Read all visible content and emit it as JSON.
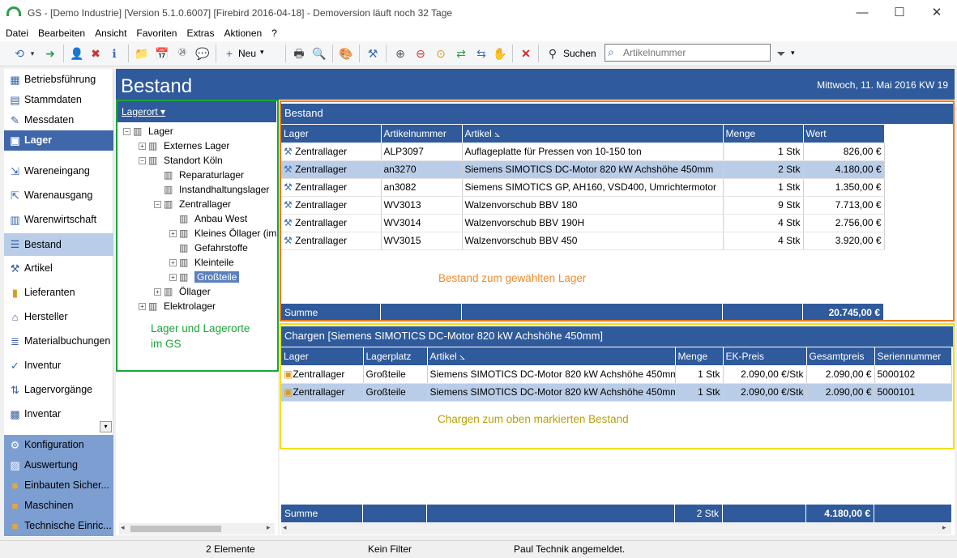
{
  "window": {
    "title": "GS - [Demo Industrie]  [Version  5.1.0.6007]  [Firebird 2016-04-18]  - Demoversion läuft noch 32 Tage",
    "minimize": "—",
    "maximize": "☐",
    "close": "✕"
  },
  "menu": [
    "Datei",
    "Bearbeiten",
    "Ansicht",
    "Favoriten",
    "Extras",
    "Aktionen",
    "?"
  ],
  "toolbar": {
    "new_label": "Neu",
    "search_label": "Suchen",
    "search_placeholder": "Artikelnummer"
  },
  "nav": {
    "top": [
      "Betriebsführung",
      "Stammdaten",
      "Messdaten",
      "Lager"
    ],
    "sub": [
      "Wareneingang",
      "Warenausgang",
      "Warenwirtschaft",
      "Bestand",
      "Artikel",
      "Lieferanten",
      "Hersteller",
      "Materialbuchungen",
      "Inventur",
      "Lagervorgänge",
      "Inventar"
    ],
    "groups": [
      "Konfiguration",
      "Auswertung",
      "Einbauten Sicher...",
      "Maschinen",
      "Technische Einric..."
    ]
  },
  "header": {
    "title": "Bestand",
    "date": "Mittwoch, 11. Mai 2016  KW 19"
  },
  "tree": {
    "header": "Lagerort ▾",
    "nodes": [
      "Lager",
      "Externes Lager",
      "Standort Köln",
      "Reparaturlager",
      "Instandhaltungslager",
      "Zentrallager",
      "Anbau West",
      "Kleines Öllager (im",
      "Gefahrstoffe",
      "Kleinteile",
      "Großteile",
      "Öllager",
      "Elektrolager"
    ],
    "annotation": "Lager und Lagerorte\nim GS"
  },
  "stock": {
    "title": "Bestand",
    "columns": [
      "Lager",
      "Artikelnummer",
      "Artikel ⦣",
      "Menge",
      "Wert"
    ],
    "rows": [
      [
        "Zentrallager",
        "ALP3097",
        "Auflageplatte für Pressen von 10-150 ton",
        "1 Stk",
        "826,00 €"
      ],
      [
        "Zentrallager",
        "an3270",
        "Siemens SIMOTICS DC-Motor 820 kW  Achshöhe 450mm",
        "2 Stk",
        "4.180,00 €"
      ],
      [
        "Zentrallager",
        "an3082",
        "Siemens SIMOTICS GP, AH160, VSD400, Umrichtermotor",
        "1 Stk",
        "1.350,00 €"
      ],
      [
        "Zentrallager",
        "WV3013",
        "Walzenvorschub BBV 180",
        "9 Stk",
        "7.713,00 €"
      ],
      [
        "Zentrallager",
        "WV3014",
        "Walzenvorschub BBV 190H",
        "4 Stk",
        "2.756,00 €"
      ],
      [
        "Zentrallager",
        "WV3015",
        "Walzenvorschub BBV 450",
        "4 Stk",
        "3.920,00 €"
      ]
    ],
    "sum_label": "Summe",
    "sum_value": "20.745,00 €",
    "annotation": "Bestand zum gewählten Lager"
  },
  "batches": {
    "title": "Chargen [Siemens SIMOTICS DC-Motor 820 kW  Achshöhe 450mm]",
    "columns": [
      "Lager",
      "Lagerplatz",
      "Artikel ⦣",
      "Menge",
      "EK-Preis",
      "Gesamtpreis",
      "Seriennummer"
    ],
    "rows": [
      [
        "Zentrallager",
        "Großteile",
        "Siemens SIMOTICS DC-Motor 820 kW  Achshöhe 450mm",
        "1 Stk",
        "2.090,00 €/Stk",
        "2.090,00 €",
        "5000102"
      ],
      [
        "Zentrallager",
        "Großteile",
        "Siemens SIMOTICS DC-Motor 820 kW  Achshöhe 450mm",
        "1 Stk",
        "2.090,00 €/Stk",
        "2.090,00 €",
        "5000101"
      ]
    ],
    "sum_label": "Summe",
    "sum_qty": "2 Stk",
    "sum_total": "4.180,00 €",
    "annotation": "Chargen zum oben markierten Bestand"
  },
  "status": {
    "count": "2 Elemente",
    "filter": "Kein Filter",
    "user": "Paul Technik angemeldet."
  },
  "colors": {
    "accent": "#2f5a9b",
    "tree_box": "#1aa53a",
    "stock_box": "#ef7a1a",
    "batch_box": "#f2e000",
    "stock_note": "#ef8c2a",
    "batch_note": "#b8a000",
    "tree_note": "#1aa53a"
  }
}
